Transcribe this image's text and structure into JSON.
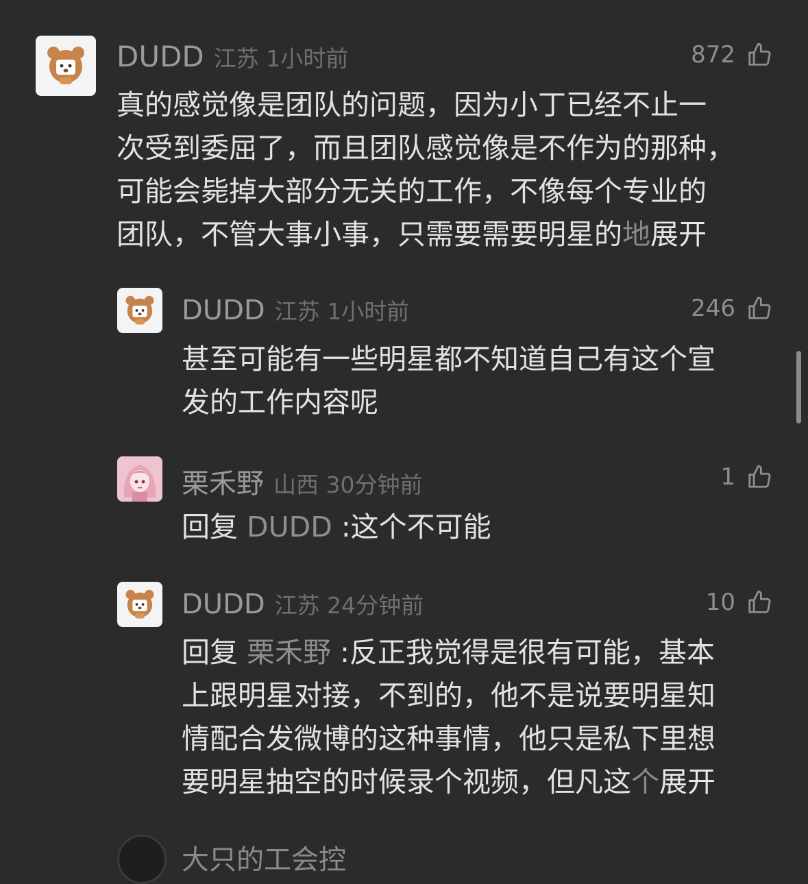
{
  "comments": [
    {
      "user": "DUDD",
      "location_time": "江苏 1小时前",
      "likes": "872",
      "lines": [
        "真的感觉像是团队的问题，因为小丁已经不止一",
        "次受到委屈了，而且团队感觉像是不作为的那种，",
        "可能会毙掉大部分无关的工作，不像每个专业的"
      ],
      "last_line": "团队，不管大事小事，只需要需要明星的",
      "last_fade": "地",
      "expand": "展开"
    },
    {
      "user": "DUDD",
      "location_time": "江苏 1小时前",
      "likes": "246",
      "lines": [
        "甚至可能有一些明星都不知道自己有这个宣",
        "发的工作内容呢"
      ]
    },
    {
      "user": "栗禾野",
      "location_time": "山西 30分钟前",
      "likes": "1",
      "reply_prefix": "回复",
      "reply_to": "DUDD",
      "text": ":这个不可能"
    },
    {
      "user": "DUDD",
      "location_time": "江苏 24分钟前",
      "likes": "10",
      "reply_prefix": "回复",
      "reply_to": "栗禾野",
      "first_text": ":反正我觉得是很有可能，基本",
      "lines": [
        "上跟明星对接，不到的，他不是说要明星知",
        "情配合发微博的这种事情，他只是私下里想"
      ],
      "last_line": "要明星抽空的时候录个视频，但凡这",
      "last_fade": "个",
      "expand": "展开"
    }
  ],
  "partial_next": {
    "text": "大只的工会控"
  },
  "icons": {
    "like": "thumbs-up-icon",
    "avatar_bear": "bear-avatar-icon"
  },
  "colors": {
    "background": "#2b2b2b",
    "username": "#9a9a9a",
    "body_text": "#e2e2e2"
  }
}
